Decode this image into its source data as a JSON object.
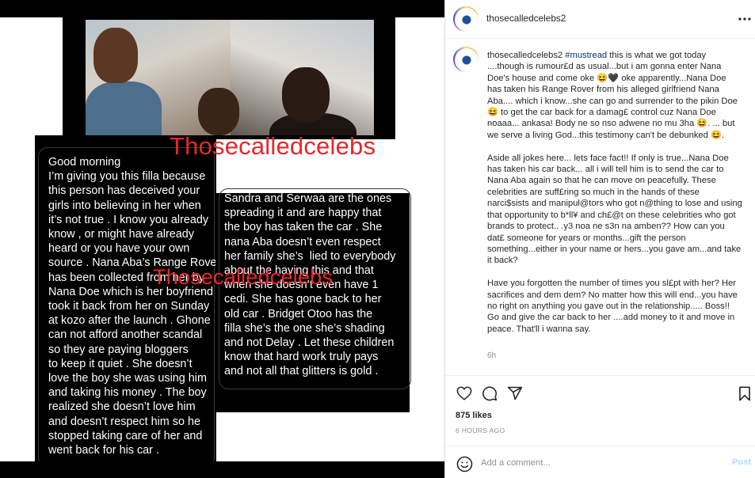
{
  "media": {
    "watermark_1": "Thosecalledcelebs",
    "watermark_2": "Thosecalledcelebs",
    "chat_1_lines": "Good morning\nI’m giving you this filla because\nthis person has deceived your\ngirls into believing in her when\nit’s not true . I know you already\nknow , or might have already\nheard or you have your own\nsource . Nana Aba’s Range Rover\nhas been collected from her by\nNana Doe which is her boyfriend\ntook it back from her on Sunday\nat kozo after the launch . Ghone\ncan not afford another scandal\nso they are paying bloggers\nto keep it quiet . She doesn’t\nlove the boy she was using him\nand taking his money . The boy\nrealized she doesn’t love him\nand doesn’t respect him so he\nstopped taking care of her and\nwent back for his car .",
    "chat_2_lines": "Sandra and Serwaa are the ones\nspreading it and are happy that\nthe boy has taken the car . She\nnana Aba doesn’t even respect\nher family she’s  lied to everybody\nabout the having this and that\nwhen she doesn’t even have 1\ncedi. She has gone back to her\nold car . Bridget Otoo has the\nfilla she’s the one she’s shading\nand not Delay . Let these children\nknow that hard work truly pays\nand not all that glitters is gold ."
  },
  "header": {
    "username": "thosecalledcelebs2",
    "more_icon": "more-horizontal-icon"
  },
  "caption": {
    "username": "thosecalledcelebs2",
    "hashtag": "#mustread",
    "body": " this is what we got today ....though is rumour£d as usual...but i am gonna enter Nana Doe's house and come oke 😆🖤 oke apparently...Nana Doe has taken his Range Rover from his alleged girlfriend Nana Aba.... which i know...she can go and surrender to the pikin Doe 😆 to get the car back for a damag£ control cuz Nana Doe noaaa... ankasa! Body ne so nso adwene no mu 3ha 😆. ... but we serve a living God...this testimony can't be debunked 😆.\n\nAside all jokes here... lets face fact!! If only is true...Nana Doe has taken his car back... all i will tell him is to send the car to Nana Aba again so that he can move on peacefully. These celebrities are suff£ring so much in the hands of these narci$sists and manipul@tors who got n@thing to lose and using that opportunity to b*ll¥ and ch£@t on these celebrities who got brands to protect.. .y3 noa ne s3n na amben?? How can you dat£ someone for years or months...gift the person something...either in your name or hers...you gave am...and take it back?\n\nHave you forgotten the number of times you sl£pt with her? Her sacrifices and dem dem? No matter how this will end...you have no right on anything you gave out in the relationship..... Boss!! Go and give the car back to her ....add money to it and move in peace. That'll i wanna say.",
    "time": "6h"
  },
  "actions": {
    "like_icon": "heart-icon",
    "comment_icon": "comment-icon",
    "share_icon": "share-icon",
    "save_icon": "bookmark-icon"
  },
  "likes": "875 likes",
  "post_time": "6 HOURS AGO",
  "comment": {
    "placeholder": "Add a comment...",
    "post_label": "Post",
    "emoji_icon": "emoji-icon"
  },
  "colors": {
    "watermark": "#e8262b",
    "hashtag": "#00376b",
    "post_button_disabled": "#b3dbff"
  }
}
